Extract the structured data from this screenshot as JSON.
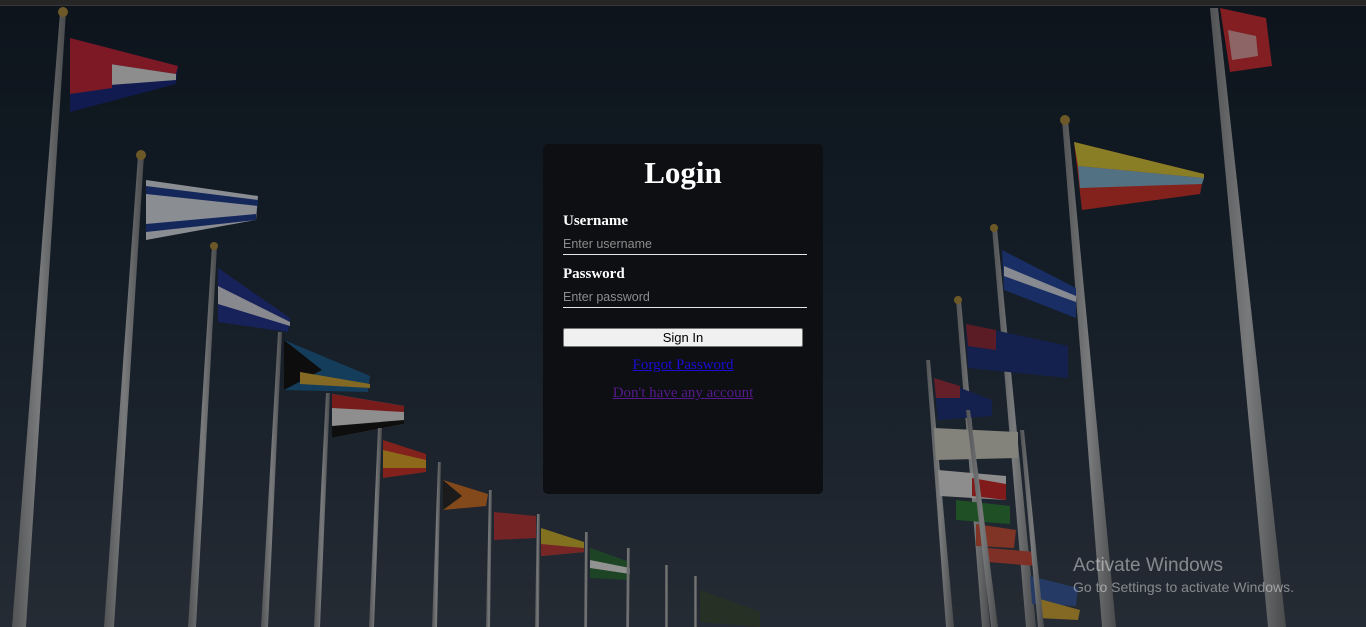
{
  "login": {
    "title": "Login",
    "username_label": "Username",
    "username_placeholder": "Enter username",
    "password_label": "Password",
    "password_placeholder": "Enter password",
    "signin_label": "Sign In",
    "forgot_label": "Forgot Password",
    "signup_label": "Don't have any account"
  },
  "watermark": {
    "title": "Activate Windows",
    "subtitle": "Go to Settings to activate Windows."
  },
  "background": {
    "description_icon": "flag-poles-photo",
    "colors": {
      "sky_top": "#141f2b",
      "sky_bottom": "#3a4350",
      "card": "#0d0f12",
      "link": "#1a0dd6",
      "visited_link": "#551a8b"
    }
  }
}
